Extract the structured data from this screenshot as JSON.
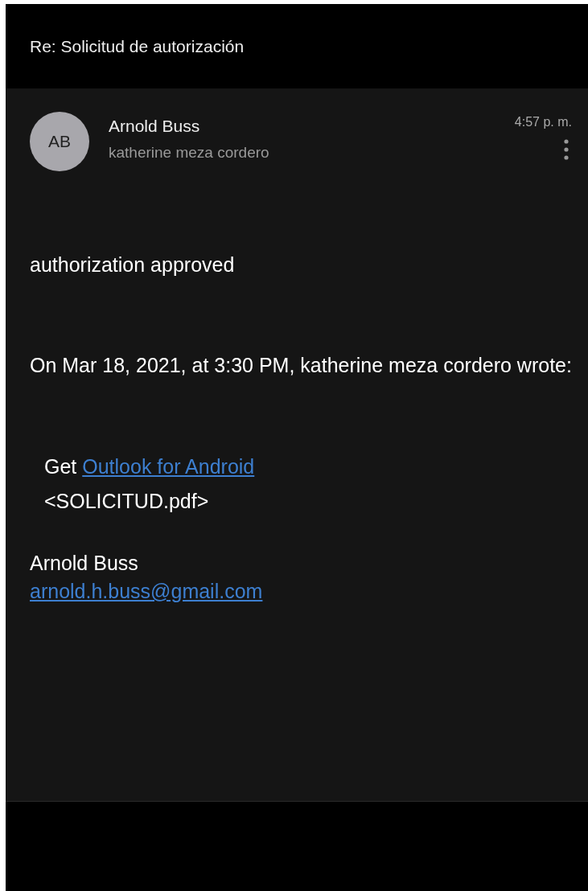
{
  "header": {
    "title": "Re: Solicitud de autorización"
  },
  "message": {
    "avatar_initials": "AB",
    "sender": "Arnold Buss",
    "recipient": "katherine meza cordero",
    "time": "4:57 p. m.",
    "body": [
      {
        "kind": "para",
        "text": "authorization approved"
      },
      {
        "kind": "para",
        "text": "On Mar 18, 2021, at 3:30 PM, katherine meza cordero wrote:"
      },
      {
        "kind": "quote",
        "prefix": "Get",
        "link": "Outlook for Android",
        "attachment": "<SOLICITUD.pdf>"
      },
      {
        "kind": "signature",
        "name": "Arnold Buss",
        "email": "arnold.h.buss@gmail.com"
      }
    ]
  }
}
